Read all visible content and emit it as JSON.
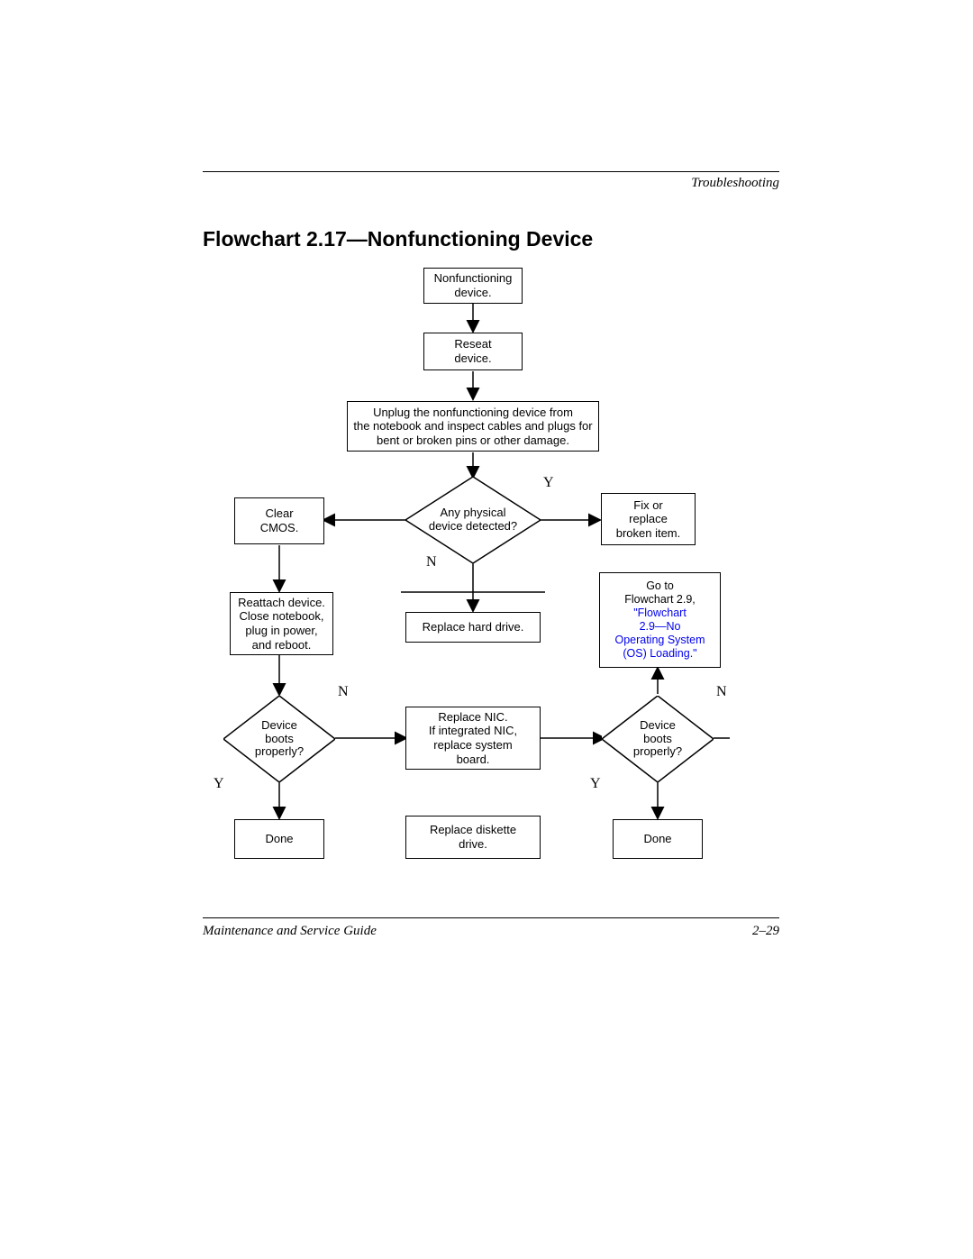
{
  "header": {
    "section": "Troubleshooting"
  },
  "title": "Flowchart 2.17—Nonfunctioning Device",
  "nodes": {
    "start": {
      "l1": "Nonfunctioning",
      "l2": "device."
    },
    "reseat": {
      "l1": "Reseat",
      "l2": "device."
    },
    "unplug": {
      "l1": "Unplug the nonfunctioning device from",
      "l2": "the notebook and inspect cables and plugs for",
      "l3": "bent or broken pins or other damage."
    },
    "clearcmos": {
      "l1": "Clear",
      "l2": "CMOS."
    },
    "detect": {
      "l1": "Any physical",
      "l2": "device detected?"
    },
    "fix": {
      "l1": "Fix or",
      "l2": "replace",
      "l3": "broken item."
    },
    "reattach": {
      "l1": "Reattach device.",
      "l2": "Close notebook,",
      "l3": "plug in power,",
      "l4": "and reboot."
    },
    "rhd": {
      "l1": "Replace hard drive."
    },
    "goto": {
      "l1": "Go to",
      "l2": "Flowchart 2.9,",
      "link1": "\"Flowchart",
      "link2": "2.9—No",
      "link3": "Operating System",
      "link4": "(OS) Loading.\""
    },
    "bootsL": {
      "l1": "Device",
      "l2": "boots",
      "l3": "properly?"
    },
    "rnic": {
      "l1": "Replace NIC.",
      "l2": "If integrated NIC,",
      "l3": "replace system",
      "l4": "board."
    },
    "bootsR": {
      "l1": "Device",
      "l2": "boots",
      "l3": "properly?"
    },
    "doneL": "Done",
    "rdk": {
      "l1": "Replace diskette",
      "l2": "drive."
    },
    "doneR": "Done"
  },
  "labels": {
    "Y": "Y",
    "N": "N"
  },
  "footer": {
    "left": "Maintenance and Service Guide",
    "right": "2–29"
  }
}
